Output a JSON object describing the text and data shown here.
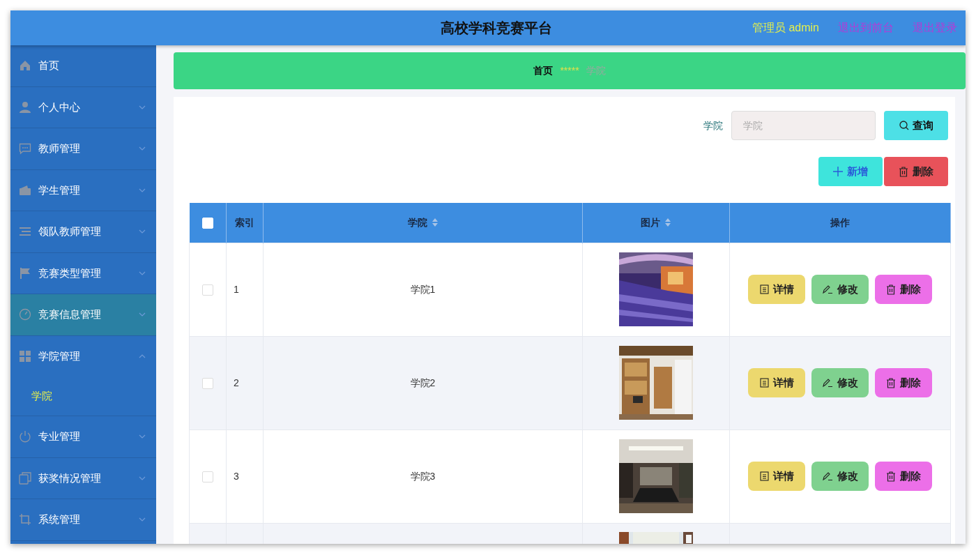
{
  "header": {
    "title": "高校学科竞赛平台",
    "user_label": "管理员 admin",
    "links": [
      "退出到前台",
      "退出登录"
    ]
  },
  "sidebar": {
    "items": [
      {
        "label": "首页",
        "kind": "link",
        "highlighted": false
      },
      {
        "label": "个人中心",
        "kind": "submenu",
        "expanded": false,
        "highlighted": false
      },
      {
        "label": "教师管理",
        "kind": "submenu",
        "expanded": false,
        "highlighted": false
      },
      {
        "label": "学生管理",
        "kind": "submenu",
        "expanded": false,
        "highlighted": false
      },
      {
        "label": "领队教师管理",
        "kind": "submenu",
        "expanded": false,
        "highlighted": false
      },
      {
        "label": "竞赛类型管理",
        "kind": "submenu",
        "expanded": false,
        "highlighted": false
      },
      {
        "label": "竞赛信息管理",
        "kind": "submenu",
        "expanded": false,
        "highlighted": true
      },
      {
        "label": "学院管理",
        "kind": "submenu",
        "expanded": true,
        "highlighted": false,
        "children": [
          {
            "label": "学院",
            "selected": true
          }
        ]
      },
      {
        "label": "专业管理",
        "kind": "submenu",
        "expanded": false,
        "highlighted": false
      },
      {
        "label": "获奖情况管理",
        "kind": "submenu",
        "expanded": false,
        "highlighted": false
      },
      {
        "label": "系统管理",
        "kind": "submenu",
        "expanded": false,
        "highlighted": false
      }
    ]
  },
  "breadcrumb": {
    "items": [
      "首页",
      "学院"
    ],
    "separator": "*****"
  },
  "search": {
    "label": "学院",
    "placeholder": "学院",
    "button": "查询"
  },
  "actions": [
    {
      "label": "新增",
      "kind": "add"
    },
    {
      "label": "删除",
      "kind": "delete"
    }
  ],
  "table": {
    "all_selected": false,
    "columns": [
      {
        "label": "索引",
        "sortable": false
      },
      {
        "label": "学院",
        "sortable": true
      },
      {
        "label": "图片",
        "sortable": true
      },
      {
        "label": "操作",
        "sortable": false
      }
    ],
    "rows": [
      {
        "selected": false,
        "index": "1",
        "name": "学院1",
        "image": {
          "kind": "picture"
        },
        "actions": [
          "详情",
          "修改",
          "删除"
        ]
      },
      {
        "selected": false,
        "index": "2",
        "name": "学院2",
        "image": {
          "kind": "picture"
        },
        "actions": [
          "详情",
          "修改",
          "删除"
        ]
      },
      {
        "selected": false,
        "index": "3",
        "name": "学院3",
        "image": {
          "kind": "picture"
        },
        "actions": [
          "详情",
          "修改",
          "删除"
        ]
      }
    ],
    "partial_row": {
      "image": {
        "kind": "picture"
      }
    }
  }
}
